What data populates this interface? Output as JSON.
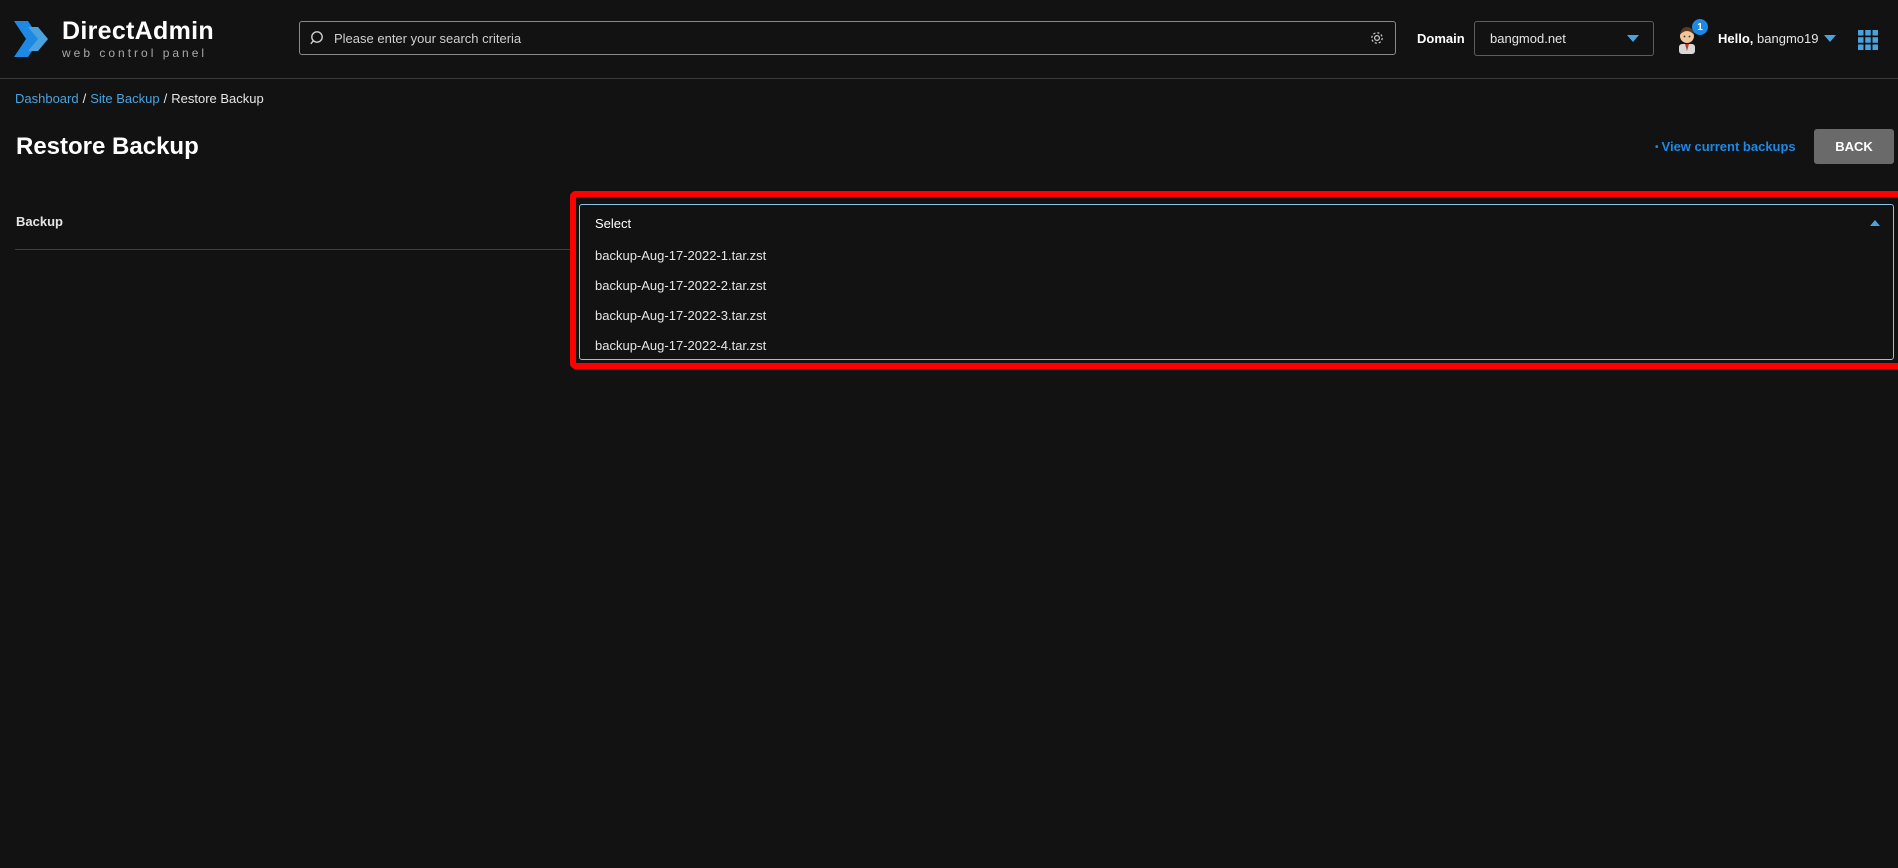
{
  "header": {
    "logo_title": "DirectAdmin",
    "logo_subtitle": "web control panel",
    "search_placeholder": "Please enter your search criteria",
    "domain_label": "Domain",
    "domain_value": "bangmod.net",
    "notification_count": "1",
    "hello_prefix": "Hello,",
    "username": "bangmo19"
  },
  "breadcrumb": {
    "items": [
      "Dashboard",
      "Site Backup",
      "Restore Backup"
    ]
  },
  "page": {
    "title": "Restore Backup",
    "view_backups_link": "View current backups",
    "back_button": "BACK"
  },
  "form": {
    "backup_label": "Backup",
    "select_placeholder": "Select",
    "options": [
      "backup-Aug-17-2022-1.tar.zst",
      "backup-Aug-17-2022-2.tar.zst",
      "backup-Aug-17-2022-3.tar.zst",
      "backup-Aug-17-2022-4.tar.zst"
    ]
  },
  "colors": {
    "accent": "#4aa3df",
    "link": "#1e88e5",
    "highlight": "#ff0000",
    "background": "#121212"
  }
}
